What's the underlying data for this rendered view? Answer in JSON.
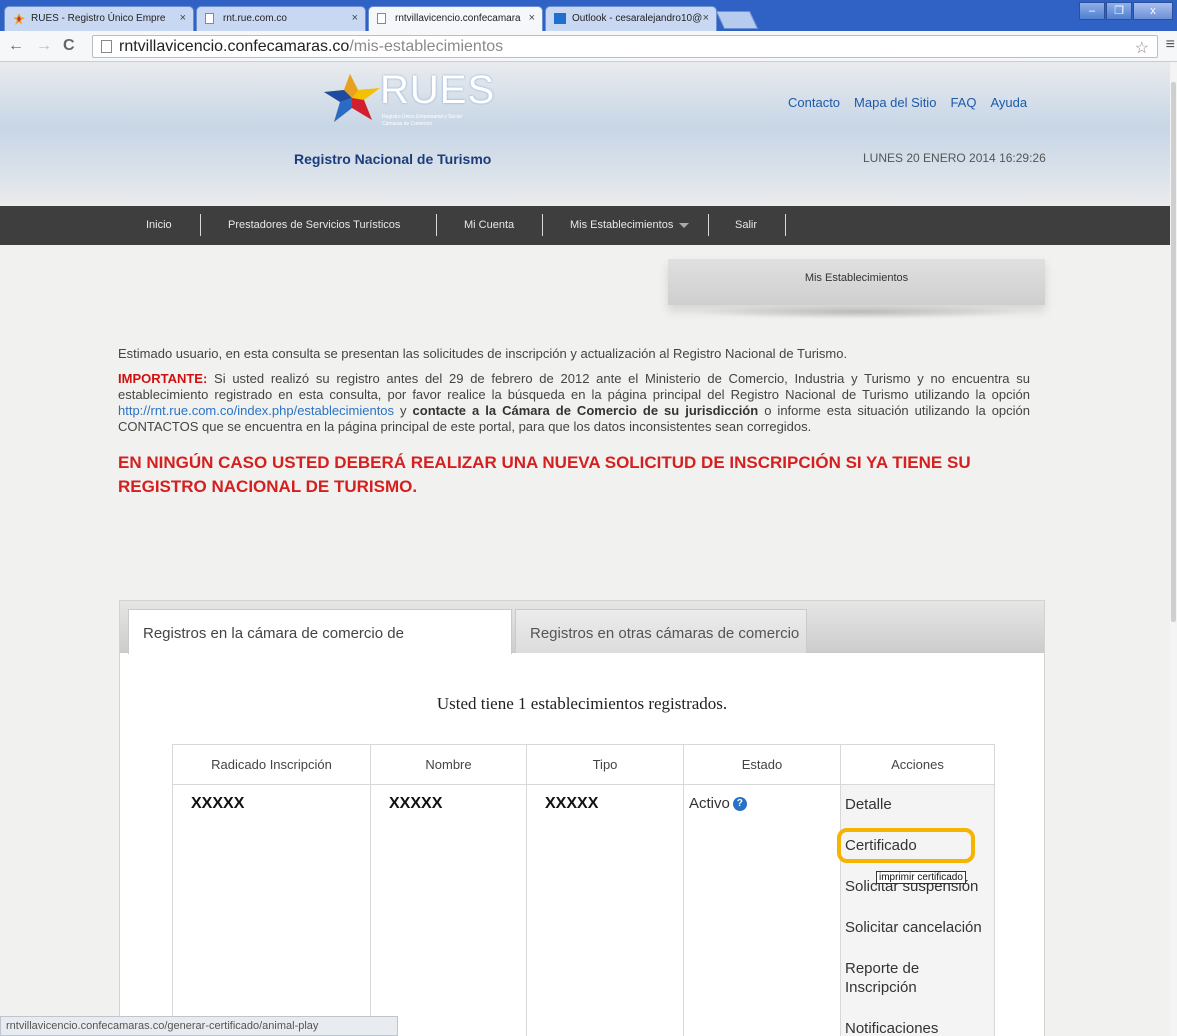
{
  "browser": {
    "tabs": [
      {
        "label": "RUES - Registro Único Empre",
        "close": "×"
      },
      {
        "label": "rnt.rue.com.co",
        "close": "×"
      },
      {
        "label": "rntvillavicencio.confecamara",
        "close": "×"
      },
      {
        "label": "Outlook - cesaralejandro10@",
        "close": "×"
      }
    ],
    "url_host": "rntvillavicencio.confecamaras.co",
    "url_path": "/mis-establecimientos",
    "status_url": "rntvillavicencio.confecamaras.co/generar-certificado/animal-play"
  },
  "header": {
    "logo_title": "RUES",
    "logo_sub1": "Registro Único Empresarial y Social",
    "logo_sub2": "Cámaras de Comercio",
    "site_title": "Registro Nacional de Turismo",
    "links": [
      "Contacto",
      "Mapa del Sitio",
      "FAQ",
      "Ayuda"
    ],
    "datetime": "LUNES 20 ENERO 2014 16:29:26"
  },
  "nav": {
    "items": [
      "Inicio",
      "Prestadores de Servicios Turísticos",
      "Mi Cuenta",
      "Mis Establecimientos",
      "Salir"
    ]
  },
  "breadcrumb": "Mis Establecimientos",
  "content": {
    "intro": "Estimado usuario, en esta consulta se presentan las solicitudes de inscripción y actualización al Registro Nacional de Turismo.",
    "important_label": "IMPORTANTE:",
    "important_text1": " Si usted realizó su registro antes del 29 de febrero de 2012 ante el Ministerio de Comercio, Industria y Turismo y no encuentra su establecimiento registrado en esta consulta, por favor realice la búsqueda en la página principal del Registro Nacional de Turismo utilizando la opción ",
    "important_link": "http://rnt.rue.com.co/index.php/establecimientos",
    "important_text2": " y ",
    "important_bold": "contacte a la Cámara de Comercio de su jurisdicción",
    "important_text3": " o informe esta situación utilizando la opción CONTACTOS que se encuentra en la página principal de este portal, para que los datos inconsistentes sean corregidos.",
    "warning": "EN NINGÚN CASO USTED DEBERÁ REALIZAR UNA NUEVA SOLICITUD DE  INSCRIPCIÓN SI YA TIENE SU REGISTRO NACIONAL DE TURISMO."
  },
  "panel": {
    "tabs": [
      "Registros en la cámara de comercio de",
      "Registros en otras cámaras de comercio"
    ],
    "count_text": "Usted tiene 1 establecimientos registrados.",
    "columns": [
      "Radicado Inscripción",
      "Nombre",
      "Tipo",
      "Estado",
      "Acciones"
    ],
    "row": {
      "radicado": "XXXXX",
      "nombre": "XXXXX",
      "tipo": "XXXXX",
      "estado": "Activo",
      "actions": [
        "Detalle",
        "Certificado",
        "Solicitar suspensión",
        "Solicitar cancelación",
        "Reporte de Inscripción",
        "Notificaciones"
      ]
    },
    "tooltip": "imprimir certificado"
  },
  "colors": {
    "highlight": "#f5b400",
    "warning_red": "#d52020",
    "nav_bg": "#3e3e3e",
    "link_blue": "#2b73c5"
  }
}
